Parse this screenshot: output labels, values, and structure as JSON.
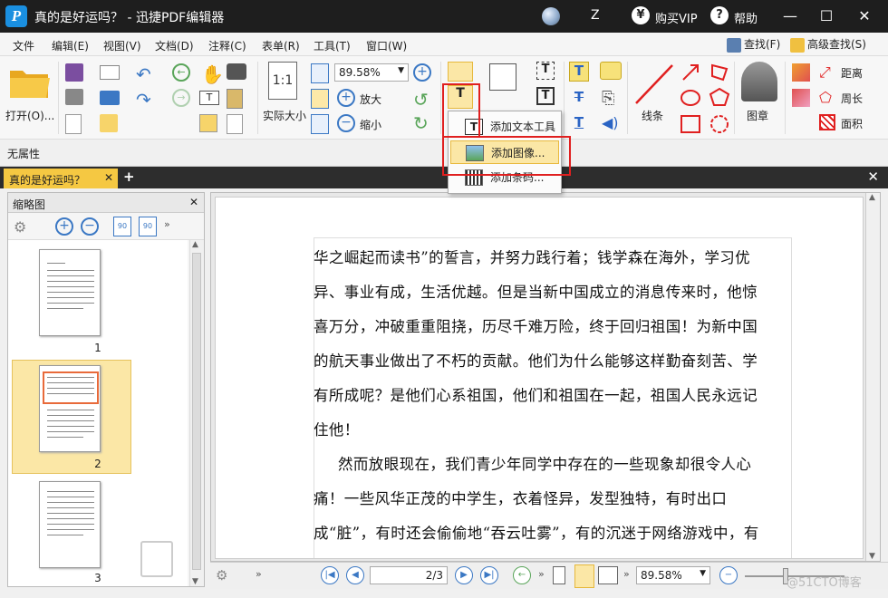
{
  "window": {
    "title": "真的是好运吗？ - 迅捷PDF编辑器",
    "logo": "P",
    "user": "Z",
    "vip_label": "购买VIP",
    "help_label": "帮助"
  },
  "menu": {
    "items": [
      "文件",
      "编辑(E)",
      "视图(V)",
      "文档(D)",
      "注释(C)",
      "表单(R)",
      "工具(T)",
      "窗口(W)"
    ],
    "find": "查找(F)",
    "advanced_find": "高级查找(S)"
  },
  "ribbon": {
    "open_label": "打开(O)...",
    "actual_size_label": "实际大小",
    "actual_size_icon_text": "1:1",
    "zoom_value": "89.58%",
    "zoom_in_label": "放大",
    "zoom_out_label": "缩小",
    "line_label": "线条",
    "stamp_label": "图章",
    "distance_label": "距离",
    "perimeter_label": "周长",
    "area_label": "面积"
  },
  "dropdown": {
    "items": [
      "添加文本工具",
      "添加图像...",
      "添加条码..."
    ],
    "highlighted_index": 1
  },
  "properties": {
    "label": "无属性"
  },
  "tabs": {
    "active": "真的是好运吗？"
  },
  "sidebar": {
    "title": "缩略图",
    "pages": [
      "1",
      "2",
      "3"
    ],
    "selected_page": "2"
  },
  "document": {
    "paragraphs": [
      "华之崛起而读书”的誓言，并努力践行着；钱学森在海外，学习优异、事业有成，生活优越。但是当新中国成立的消息传来时，他惊喜万分，冲破重重阻挠，历尽千难万险，终于回归祖国！为新中国的航天事业做出了不朽的贡献。他们为什么能够这样勤奋刻苦、学有所成呢？是他们心系祖国，他们和祖国在一起，祖国人民永远记住他！",
      "然而放眼现在，我们青少年同学中存在的一些现象却很令人心痛！一些风华正茂的中学生，衣着怪异，发型独特，有时出口成“脏”，有时还会偷偷地“吞云吐雾”，有的沉迷于网络游戏中，有的沉浸在言情、魔幻小说的世界里……不知道他"
    ]
  },
  "status": {
    "page_value": "2/3",
    "zoom_value": "89.58%"
  },
  "watermark": "@51CTO博客"
}
